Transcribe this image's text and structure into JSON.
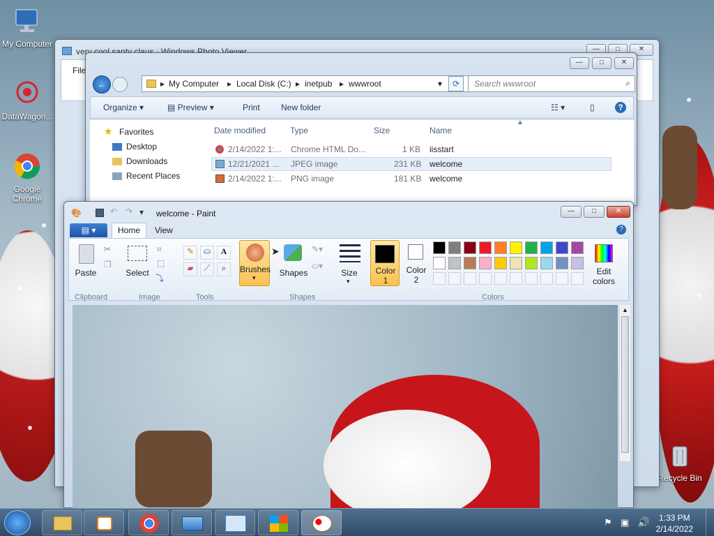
{
  "desktop": {
    "icons": [
      {
        "label": "My Computer",
        "icon": "computer-icon"
      },
      {
        "label": "DataWagon...",
        "icon": "datawagon-icon"
      },
      {
        "label": "Google Chrome",
        "icon": "chrome-icon"
      },
      {
        "label": "Recycle Bin",
        "icon": "recycle-bin-icon"
      }
    ]
  },
  "photo_viewer": {
    "title": "very cool santy claus - Windows Photo Viewer",
    "menu_file": "File"
  },
  "explorer": {
    "breadcrumb": [
      "My Computer",
      "Local Disk (C:)",
      "inetpub",
      "wwwroot"
    ],
    "search_placeholder": "Search wwwroot",
    "toolbar": {
      "organize": "Organize",
      "preview": "Preview",
      "print": "Print",
      "new_folder": "New folder"
    },
    "nav": {
      "favorites": "Favorites",
      "items": [
        "Desktop",
        "Downloads",
        "Recent Places"
      ]
    },
    "columns": {
      "date": "Date modified",
      "type": "Type",
      "size": "Size",
      "name": "Name"
    },
    "rows": [
      {
        "date": "2/14/2022 1:...",
        "type": "Chrome HTML Do...",
        "size": "1 KB",
        "name": "iisstart"
      },
      {
        "date": "12/21/2021 ...",
        "type": "JPEG image",
        "size": "231 KB",
        "name": "welcome"
      },
      {
        "date": "2/14/2022 1:...",
        "type": "PNG image",
        "size": "181 KB",
        "name": "welcome"
      }
    ]
  },
  "paint": {
    "title": "welcome - Paint",
    "tabs": {
      "home": "Home",
      "view": "View"
    },
    "groups": {
      "clipboard": "Clipboard",
      "image": "Image",
      "tools": "Tools",
      "shapes": "Shapes",
      "colors": "Colors"
    },
    "labels": {
      "paste": "Paste",
      "select": "Select",
      "brushes": "Brushes",
      "shapes": "Shapes",
      "size": "Size",
      "color1": "Color",
      "color1_num": "1",
      "color2": "Color",
      "color2_num": "2",
      "edit_colors": "Edit",
      "edit_colors2": "colors"
    },
    "palette_row1": [
      "#000000",
      "#7f7f7f",
      "#880015",
      "#ed1c24",
      "#ff7f27",
      "#fff200",
      "#22b14c",
      "#00a2e8",
      "#3f48cc",
      "#a349a4"
    ],
    "palette_row2": [
      "#ffffff",
      "#c3c3c3",
      "#b97a57",
      "#ffaec9",
      "#ffc90e",
      "#efe4b0",
      "#b5e61d",
      "#99d9ea",
      "#7092be",
      "#c8bfe7"
    ]
  },
  "taskbar": {
    "time": "1:33 PM",
    "date": "2/14/2022"
  }
}
